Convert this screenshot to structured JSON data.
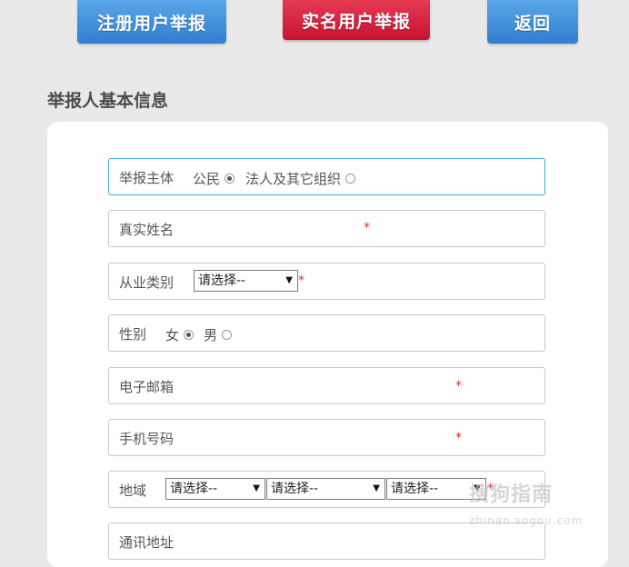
{
  "top_buttons": {
    "registered_report": "注册用户举报",
    "realname_report": "实名用户举报",
    "back": "返回"
  },
  "section_title": "举报人基本信息",
  "form": {
    "subject": {
      "label": "举报主体",
      "options": [
        "公民",
        "法人及其它组织"
      ],
      "selected": "公民"
    },
    "real_name": {
      "label": "真实姓名",
      "required_mark": "*"
    },
    "occupation": {
      "label": "从业类别",
      "select_value": "请选择--",
      "required_mark": "*"
    },
    "gender": {
      "label": "性别",
      "options": [
        "女",
        "男"
      ],
      "selected": "女"
    },
    "email": {
      "label": "电子邮箱",
      "required_mark": "*"
    },
    "phone": {
      "label": "手机号码",
      "required_mark": "*"
    },
    "region": {
      "label": "地域",
      "selects": [
        "请选择--",
        "请选择--",
        "请选择--"
      ],
      "required_mark": "*"
    },
    "address": {
      "label": "通讯地址"
    }
  },
  "watermark": {
    "text": "搜狗指南",
    "sub": "zhinan.sogou.com"
  },
  "colors": {
    "blue_button": "#3b8de0",
    "red_button": "#d41e3a",
    "active_border": "#49a7db",
    "required": "#e03030"
  }
}
